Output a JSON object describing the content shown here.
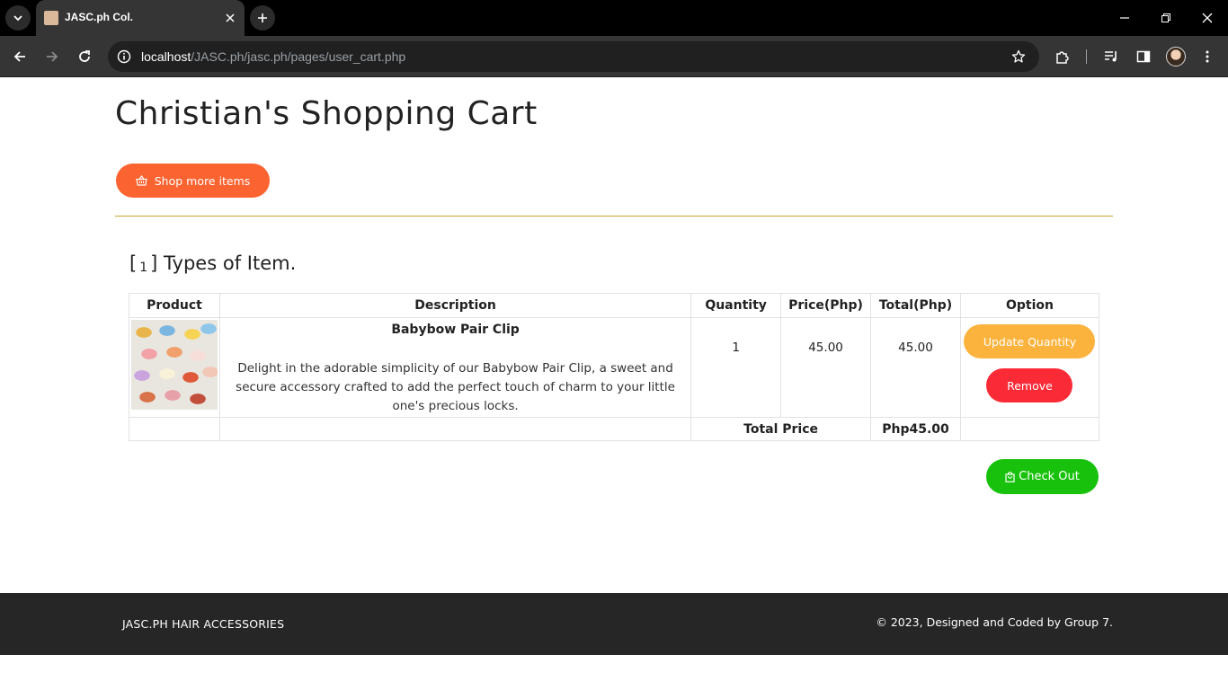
{
  "browser": {
    "tab_title": "JASC.ph Col.",
    "url_host": "localhost",
    "url_path": "/JASC.ph/jasc.ph/pages/user_cart.php"
  },
  "page": {
    "title": "Christian's Shopping Cart",
    "shop_more_label": "Shop more items",
    "types_prefix": "[",
    "types_count": "1",
    "types_suffix": "] Types of Item."
  },
  "cart": {
    "headers": {
      "product": "Product",
      "description": "Description",
      "quantity": "Quantity",
      "price": "Price(Php)",
      "total": "Total(Php)",
      "option": "Option"
    },
    "items": [
      {
        "name": "Babybow Pair Clip",
        "description": "Delight in the adorable simplicity of our Babybow Pair Clip, a sweet and secure accessory crafted to add the perfect touch of charm to your little one's precious locks.",
        "quantity": "1",
        "price": "45.00",
        "total": "45.00",
        "update_label": "Update Quantity",
        "remove_label": "Remove"
      }
    ],
    "total_label": "Total Price",
    "total_value": "Php45.00"
  },
  "checkout_label": "Check Out",
  "footer": {
    "brand": "JASC.PH HAIR ACCESSORIES",
    "credit": "© 2023, Designed and Coded by Group 7."
  },
  "colors": {
    "shop_button": "#fb6330",
    "update_button": "#fbb33d",
    "remove_button": "#fb2a37",
    "checkout_button": "#18c20c",
    "divider": "#c9a52c",
    "footer_bg": "#262626"
  }
}
